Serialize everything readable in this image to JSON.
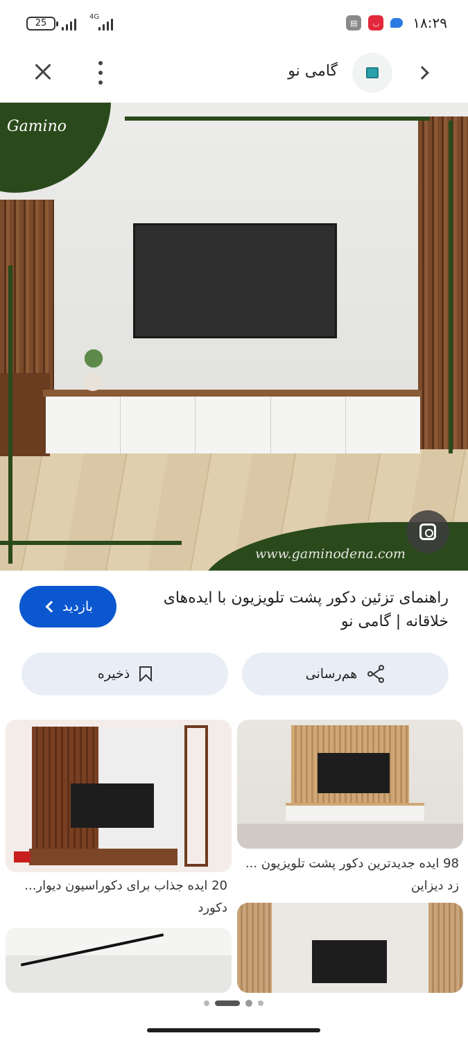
{
  "status_bar": {
    "battery": "25",
    "network": "4G",
    "time": "۱۸:۲۹"
  },
  "app_bar": {
    "site_name": "گامی نو"
  },
  "hero": {
    "logo_text": "Gamino",
    "watermark": "www.gaminodena.com"
  },
  "result": {
    "title": "راهنمای تزئین دکور پشت تلویزیون با ایده‌های خلاقانه | گامی نو",
    "visit_label": "بازدید"
  },
  "actions": {
    "share_label": "هم‌رسانی",
    "save_label": "ذخیره"
  },
  "related": [
    {
      "caption": "98 ایده جدیدترین دکور پشت تلویزیون ... زد دیزاین"
    },
    {
      "caption": "20 ایده جذاب برای دکوراسیون دیوار... دکورد"
    }
  ],
  "colors": {
    "accent_blue": "#0b57d0",
    "chip_bg": "#e9eef6",
    "brand_green": "#2b4a1c"
  }
}
